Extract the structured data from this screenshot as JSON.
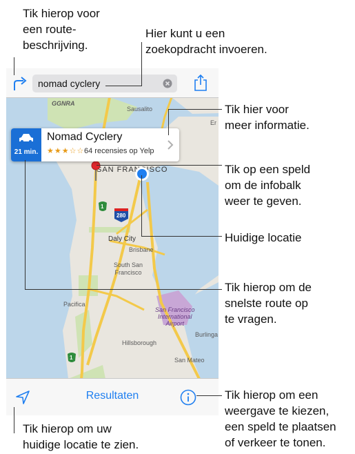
{
  "callouts": {
    "route": "Tik hierop voor\neen route-\nbeschrijving.",
    "search": "Hier kunt u een\nzoekopdracht invoeren.",
    "info": "Tik hier voor\nmeer informatie.",
    "pin": "Tik op een speld\nom de infobalk\nweer te geven.",
    "location": "Huidige locatie",
    "fastest": "Tik hierop om de\nsnelste route op\nte vragen.",
    "current": "Tik hierop om uw\nhuidige locatie te zien.",
    "view": "Tik hierop om een\nweergave te kiezen,\neen speld te plaatsen\nof verkeer te tonen."
  },
  "search": {
    "value": "nomad cyclery"
  },
  "card": {
    "place_name": "Nomad Cyclery",
    "stars": "★★★☆☆",
    "reviews": "64 recensies op Yelp",
    "eta": "21 min."
  },
  "bottom": {
    "results": "Resultaten"
  },
  "map_labels": {
    "ggnra": "GGNRA",
    "sausalito": "Sausalito",
    "er": "Er",
    "san_francisco": "SAN FRANCISCO",
    "daly_city": "Daly City",
    "brisbane": "Brisbane",
    "south_sf": "South San\nFrancisco",
    "pacifica": "Pacifica",
    "airport": "San Francisco\nInternational\nAirport",
    "burlingame": "Burlinga",
    "hillsborough": "Hillsborough",
    "san_mateo": "San Mateo",
    "shield_280": "280",
    "shield_1a": "1",
    "shield_1b": "1"
  },
  "icons": {
    "route": "route-arrow-icon",
    "clear": "clear-icon",
    "share": "share-icon",
    "location": "location-arrow-icon",
    "info": "info-icon",
    "car": "car-icon"
  },
  "colors": {
    "accent": "#1f7ff0",
    "pin": "#e0262c",
    "road": "#f3c94a",
    "water": "#bcd6ea",
    "land": "#e9e6df",
    "park": "#cfe3b4",
    "airport": "#c8a7d6"
  }
}
